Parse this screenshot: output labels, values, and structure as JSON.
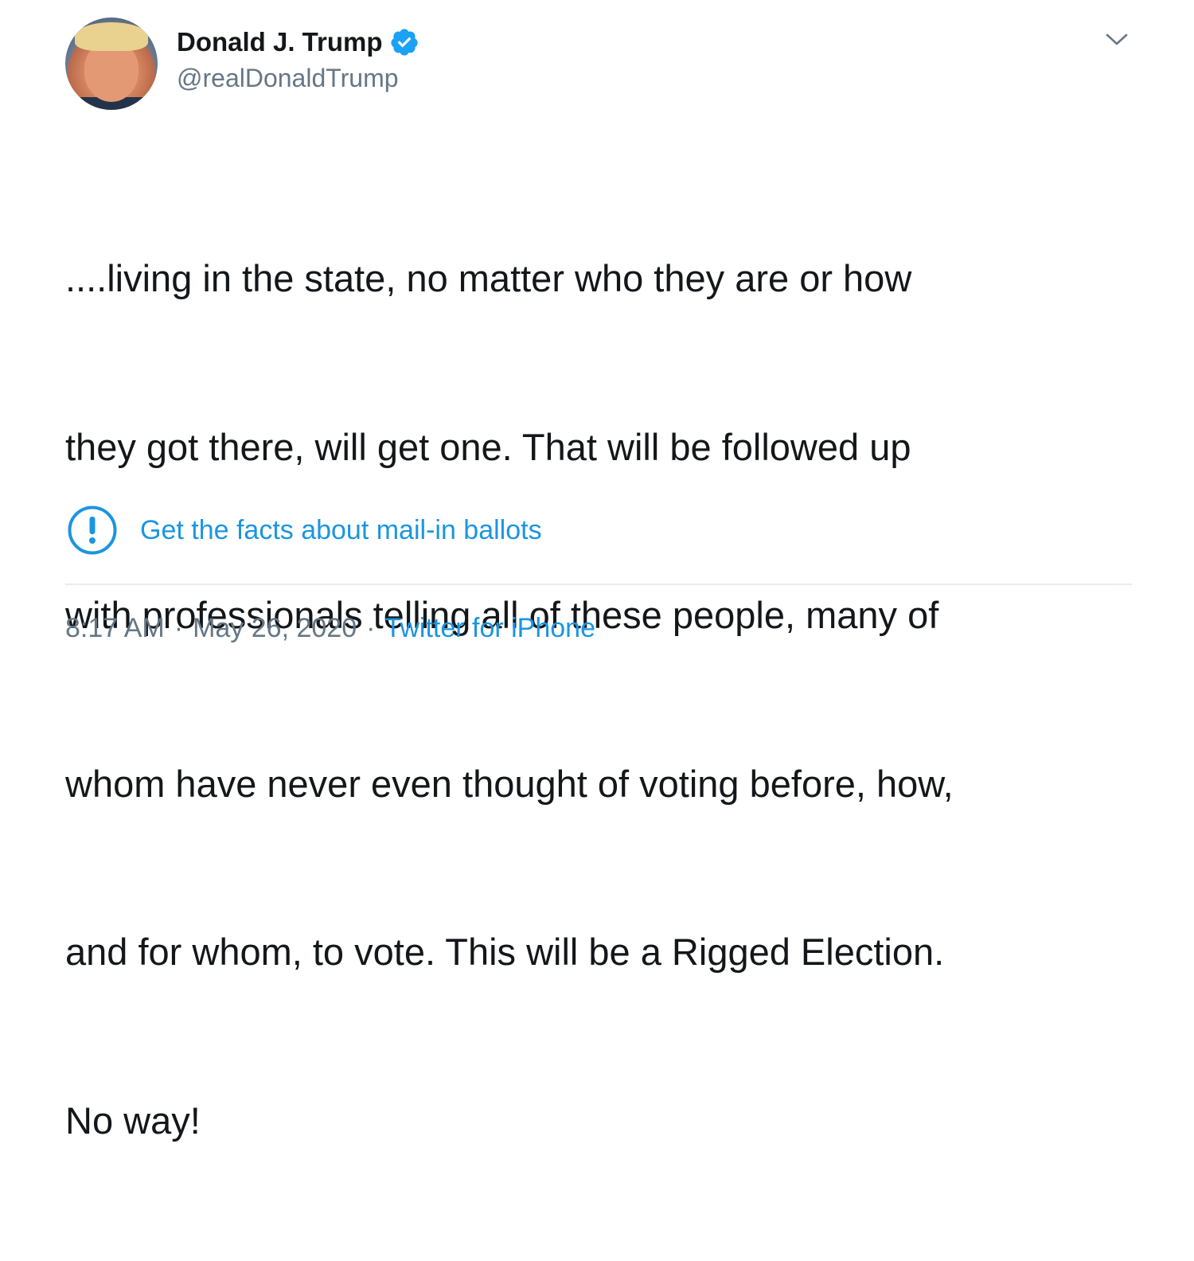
{
  "author": {
    "display_name": "Donald J. Trump",
    "handle": "@realDonaldTrump",
    "verified": true
  },
  "tweet": {
    "text_lines": [
      "....living in the state, no matter who they are or how",
      "they got there, will get one. That will be followed up",
      "with professionals telling all of these people, many of",
      "whom have never even thought of voting before, how,",
      "and for whom, to vote. This will be a Rigged Election.",
      "No way!"
    ]
  },
  "fact_check": {
    "label": "Get the facts about mail-in ballots",
    "icon": "exclamation-circle-icon"
  },
  "meta": {
    "time": "8:17 AM",
    "separator": "·",
    "date": "May 26, 2020",
    "source": "Twitter for iPhone"
  },
  "icons": {
    "verified": "verified-badge-icon",
    "menu": "chevron-down-icon"
  },
  "colors": {
    "link": "#1b95e0",
    "verified": "#1da1f2",
    "secondary_text": "#657786",
    "primary_text": "#14171a",
    "divider": "#e6ecf0"
  }
}
